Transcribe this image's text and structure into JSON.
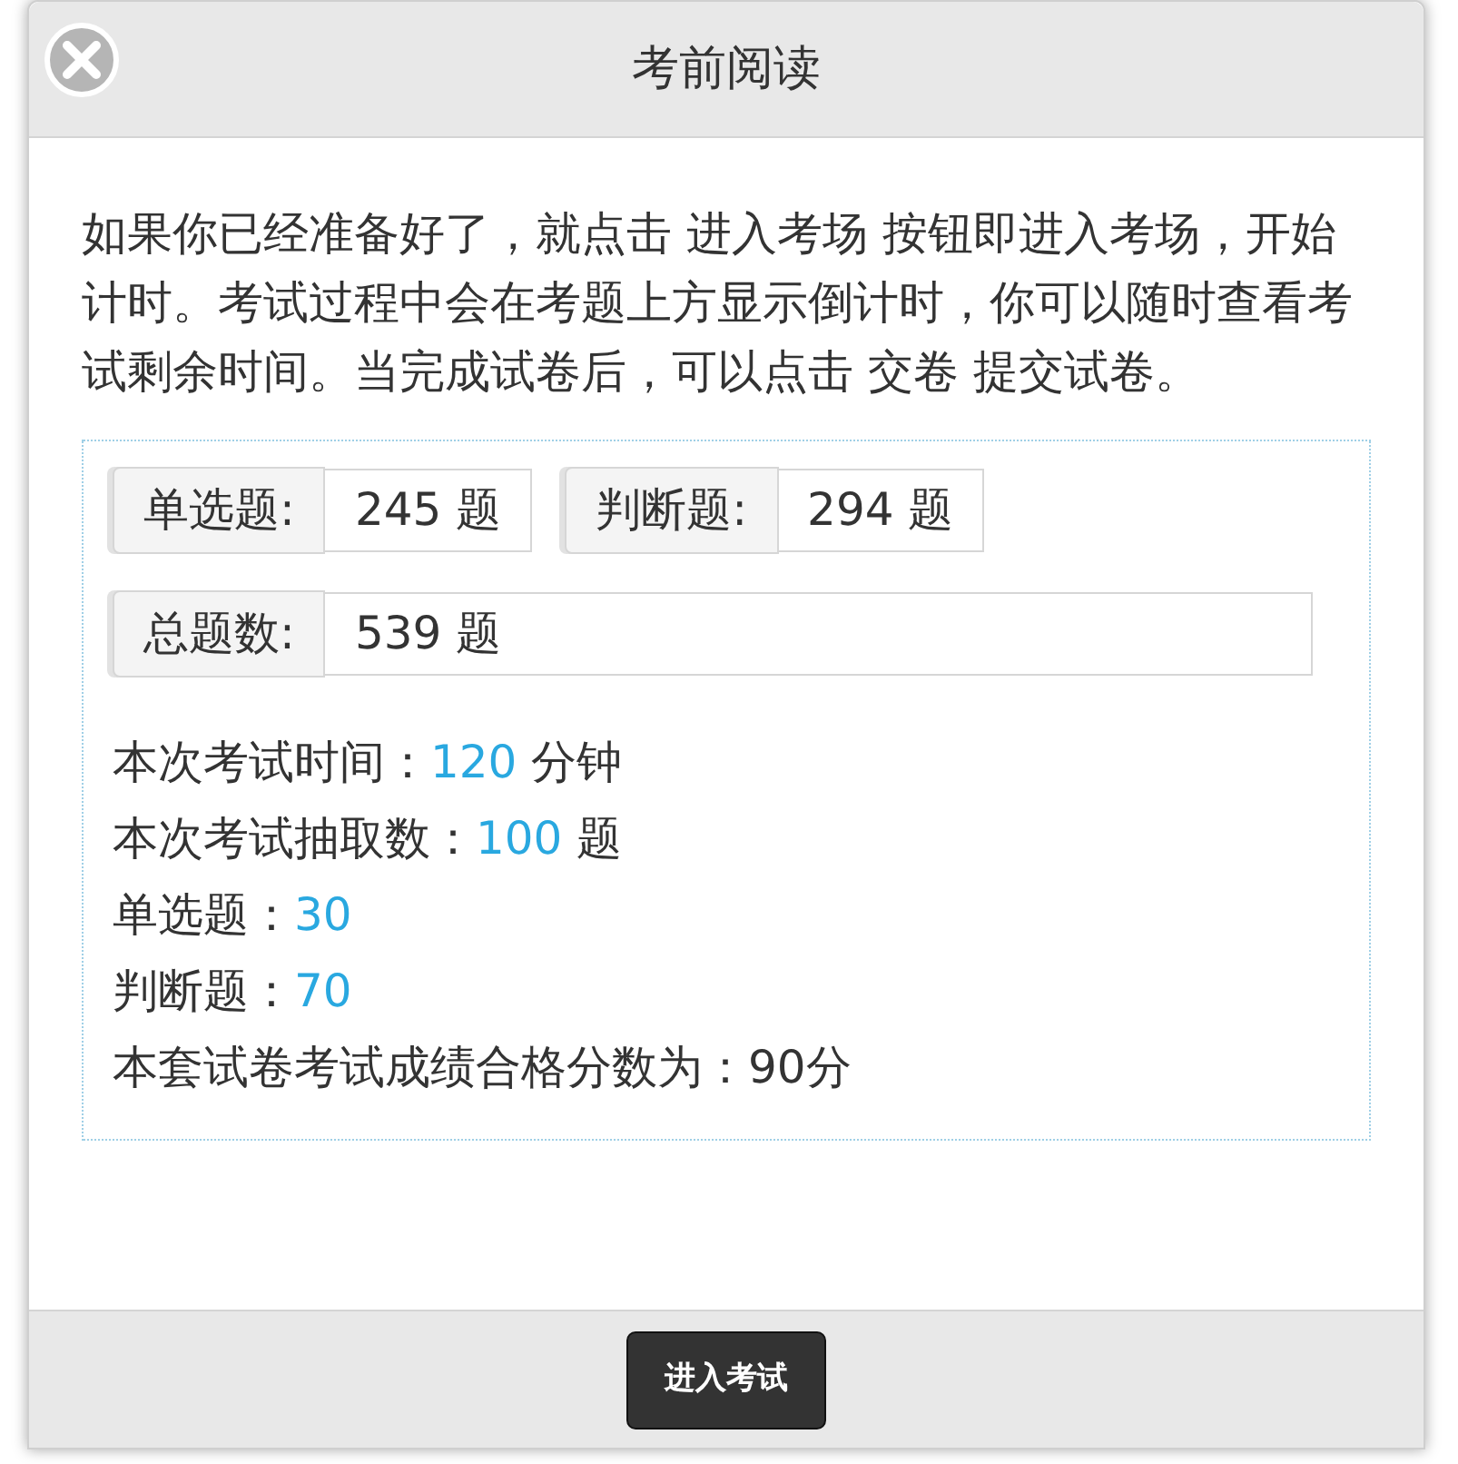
{
  "dialog": {
    "title": "考前阅读",
    "intro": "如果你已经准备好了，就点击 进入考场 按钮即进入考场，开始计时。考试过程中会在考题上方显示倒计时，你可以随时查看考试剩余时间。当完成试卷后，可以点击 交卷 提交试卷。",
    "counts": [
      {
        "label": "单选题:",
        "value": "245 题",
        "wide": false
      },
      {
        "label": "判断题:",
        "value": "294 题",
        "wide": false
      },
      {
        "label": "总题数:",
        "value": "539 题",
        "wide": true
      }
    ],
    "lines": [
      {
        "kind": "highlight",
        "label": "本次考试时间：",
        "value": "120",
        "unit": "分钟"
      },
      {
        "kind": "highlight",
        "label": "本次考试抽取数：",
        "value": "100",
        "unit": "题"
      },
      {
        "kind": "highlight",
        "label": "单选题：",
        "value": "30"
      },
      {
        "kind": "highlight",
        "label": "判断题：",
        "value": "70"
      },
      {
        "kind": "plain",
        "text": "本套试卷考试成绩合格分数为：90分"
      }
    ],
    "button": "进入考试"
  }
}
